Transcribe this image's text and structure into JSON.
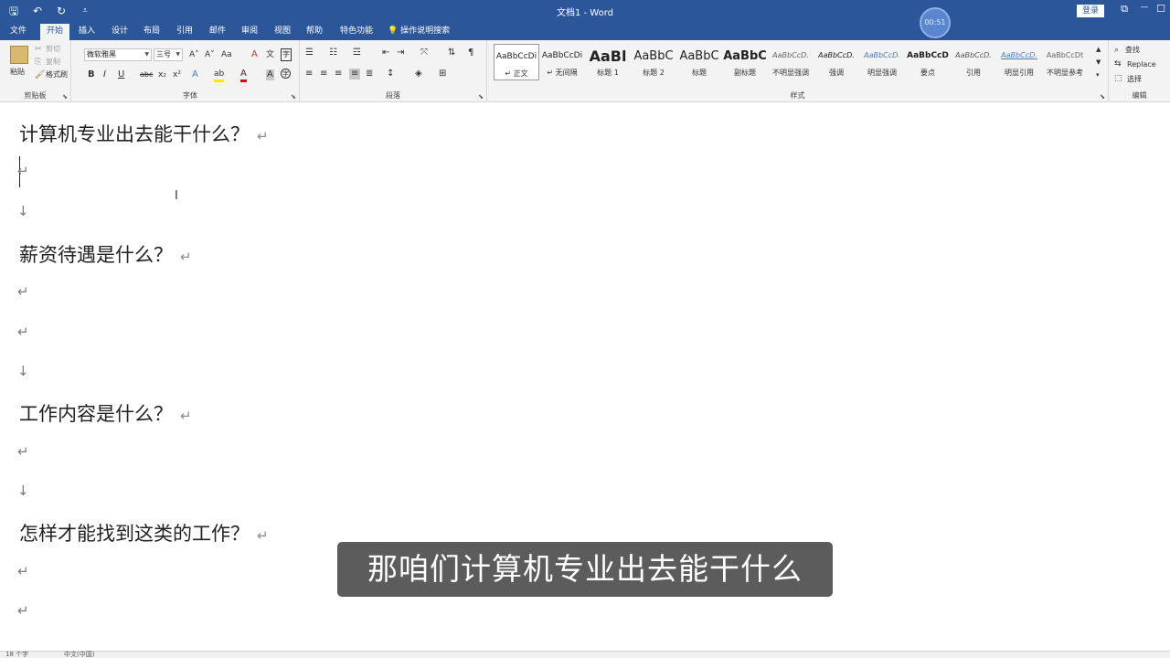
{
  "titlebar": {
    "doc_title": "文档1 - Word",
    "login_label": "登录",
    "qat": {
      "save": "🖫",
      "undo": "↶",
      "redo": "↻",
      "customize": "⩡"
    },
    "window_controls": {
      "restore": "⧉",
      "minimize": "—",
      "maximize": "☐",
      "close": "✕"
    }
  },
  "tabs": [
    {
      "label": "文件"
    },
    {
      "label": "开始"
    },
    {
      "label": "插入"
    },
    {
      "label": "设计"
    },
    {
      "label": "布局"
    },
    {
      "label": "引用"
    },
    {
      "label": "邮件"
    },
    {
      "label": "审阅"
    },
    {
      "label": "视图"
    },
    {
      "label": "帮助"
    },
    {
      "label": "特色功能"
    }
  ],
  "tell_me": {
    "icon": "💡",
    "label": "操作说明搜索"
  },
  "timer": {
    "value": "00:51"
  },
  "ribbon": {
    "clipboard": {
      "label": "剪贴板",
      "paste": "粘贴",
      "cut": "剪切",
      "copy": "复制",
      "format_painter": "格式刷"
    },
    "font": {
      "label": "字体",
      "font_name": "微软雅黑",
      "font_size": "三号",
      "bold": "B",
      "italic": "I",
      "underline": "U",
      "strike": "abc",
      "subscript": "x₂",
      "superscript": "x²",
      "grow": "A˄",
      "shrink": "A˅",
      "case": "Aa",
      "clear": "A",
      "effects": "A",
      "highlight": "ab",
      "font_color": "A",
      "char_shading": "A",
      "enclose": "字",
      "phonetic": "文"
    },
    "paragraph": {
      "label": "段落"
    },
    "styles": {
      "label": "样式",
      "items": [
        {
          "preview": "AaBbCcDi",
          "name": "↵ 正文"
        },
        {
          "preview": "AaBbCcDi",
          "name": "↵ 无间隔"
        },
        {
          "preview": "AaBl",
          "name": "标题 1"
        },
        {
          "preview": "AaBbC",
          "name": "标题 2"
        },
        {
          "preview": "AaBbC",
          "name": "标题"
        },
        {
          "preview": "AaBbC",
          "name": "副标题"
        },
        {
          "preview": "AaBbCcD.",
          "name": "不明显强调"
        },
        {
          "preview": "AaBbCcD.",
          "name": "强调"
        },
        {
          "preview": "AaBbCcD.",
          "name": "明显强调"
        },
        {
          "preview": "AaBbCcD",
          "name": "要点"
        },
        {
          "preview": "AaBbCcD.",
          "name": "引用"
        },
        {
          "preview": "AaBbCcD.",
          "name": "明显引用"
        },
        {
          "preview": "AaBbCcDt",
          "name": "不明显参考"
        }
      ]
    },
    "editing": {
      "label": "编辑",
      "find": "查找",
      "replace": "Replace",
      "select": "选择"
    }
  },
  "document": {
    "headings": [
      "计算机专业出去能干什么？",
      "薪资待遇是什么？",
      "工作内容是什么？",
      "怎样才能找到这类的工作？"
    ],
    "paragraph_mark": "↵",
    "line_break_mark": "↓",
    "ibeam": "I"
  },
  "subtitle": "那咱们计算机专业出去能干什么",
  "statusbar": {
    "word_count": "18 个字",
    "language": "中文(中国)"
  }
}
